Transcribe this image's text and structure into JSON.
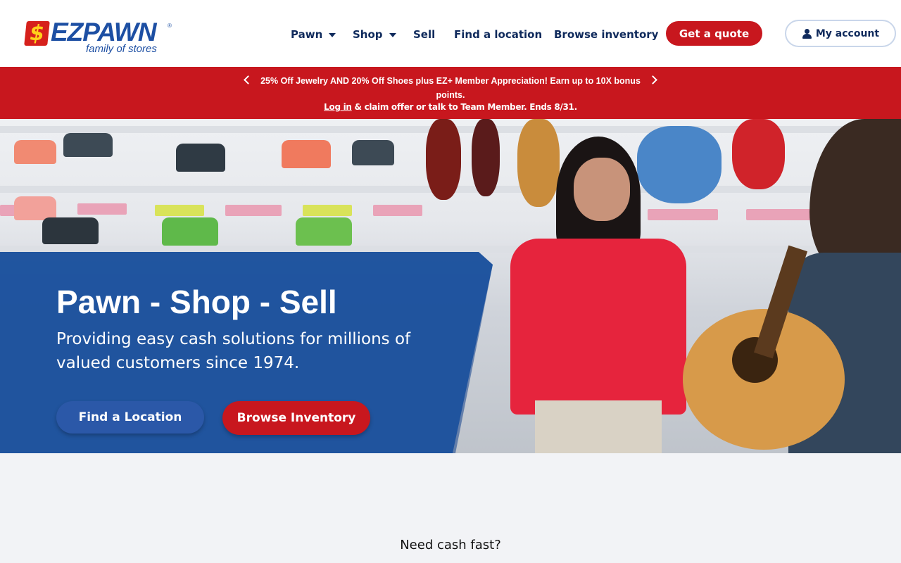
{
  "brand": {
    "logo_symbol": "$",
    "logo_word": "EZPAWN",
    "logo_tm": "®",
    "logo_sub": "family of stores"
  },
  "nav": {
    "pawn": "Pawn",
    "shop": "Shop",
    "sell": "Sell",
    "find_location": "Find a location",
    "browse_inventory": "Browse inventory",
    "get_quote": "Get a quote",
    "my_account": "My account"
  },
  "promo": {
    "line1": "25% Off Jewelry AND 20% Off Shoes plus EZ+ Member Appreciation! Earn up to 10X bonus points.",
    "login": "Log in",
    "line2_rest": " & claim offer or talk to Team Member. Ends 8/31."
  },
  "hero": {
    "title": "Pawn - Shop - Sell",
    "subtitle": "Providing easy cash solutions for millions of valued customers since 1974.",
    "find_button": "Find a Location",
    "browse_button": "Browse Inventory"
  },
  "section": {
    "heading": "Need cash fast?"
  },
  "colors": {
    "brand_red": "#c8171e",
    "brand_blue": "#2563b0",
    "nav_text": "#0f2a5c"
  },
  "icons": [
    "chevron-left-icon",
    "chevron-right-icon",
    "caret-down-icon",
    "user-icon"
  ]
}
